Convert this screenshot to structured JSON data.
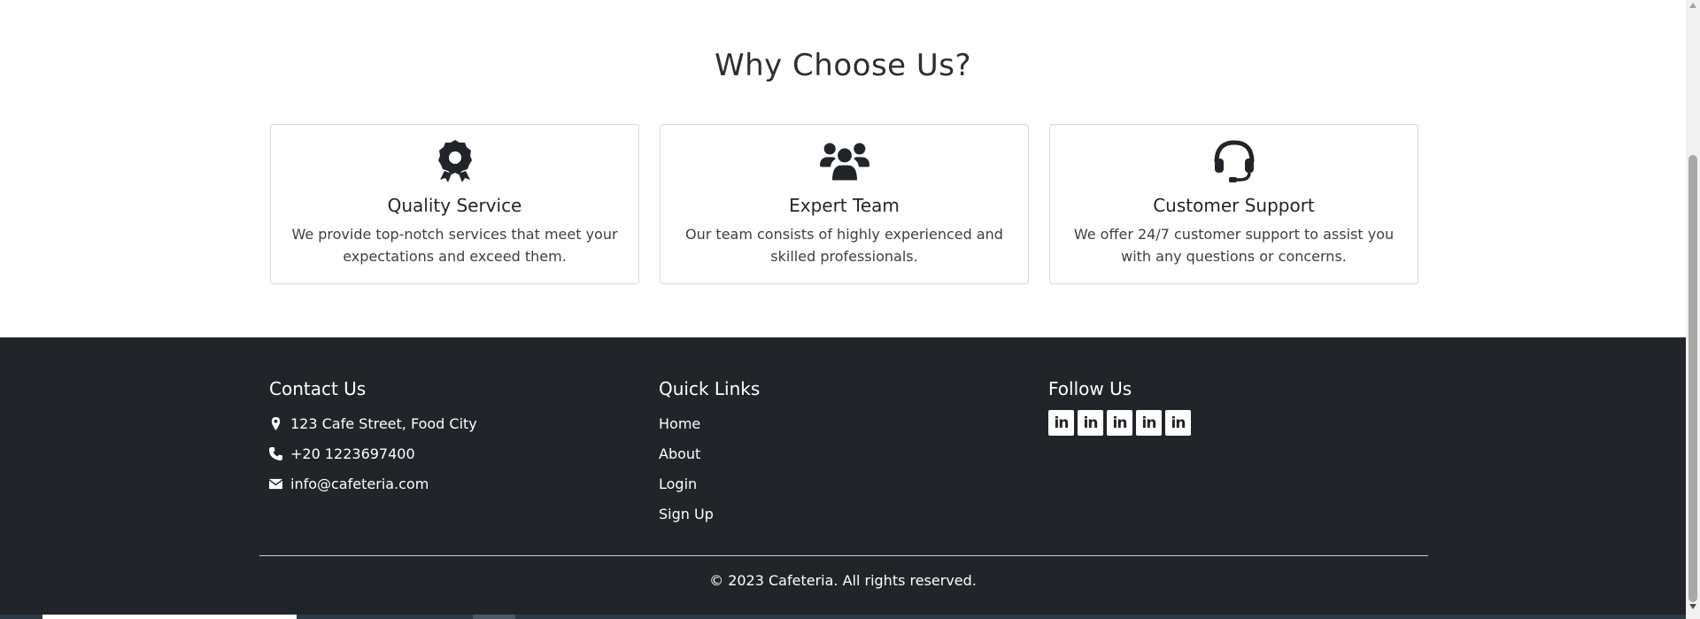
{
  "why_section": {
    "title": "Why Choose Us?",
    "cards": [
      {
        "icon": "award-icon",
        "title": "Quality Service",
        "text": "We provide top-notch services that meet your expectations and exceed them."
      },
      {
        "icon": "users-icon",
        "title": "Expert Team",
        "text": "Our team consists of highly experienced and skilled professionals."
      },
      {
        "icon": "headset-icon",
        "title": "Customer Support",
        "text": "We offer 24/7 customer support to assist you with any questions or concerns."
      }
    ]
  },
  "footer": {
    "contact": {
      "heading": "Contact Us",
      "address": "123 Cafe Street, Food City",
      "phone": "+20 1223697400",
      "email": "info@cafeteria.com"
    },
    "quick_links": {
      "heading": "Quick Links",
      "links": [
        "Home",
        "About",
        "Login",
        "Sign Up"
      ]
    },
    "follow": {
      "heading": "Follow Us",
      "socials": [
        {
          "icon": "linkedin-icon",
          "label": "in"
        },
        {
          "icon": "linkedin-icon",
          "label": "in"
        },
        {
          "icon": "linkedin-icon",
          "label": "in"
        },
        {
          "icon": "linkedin-icon",
          "label": "in"
        },
        {
          "icon": "linkedin-icon",
          "label": "in"
        }
      ]
    },
    "copyright": "© 2023 Cafeteria. All rights reserved."
  },
  "colors": {
    "footer_bg": "#212529",
    "text_dark": "#212529",
    "card_border": "#d6d9dc"
  }
}
